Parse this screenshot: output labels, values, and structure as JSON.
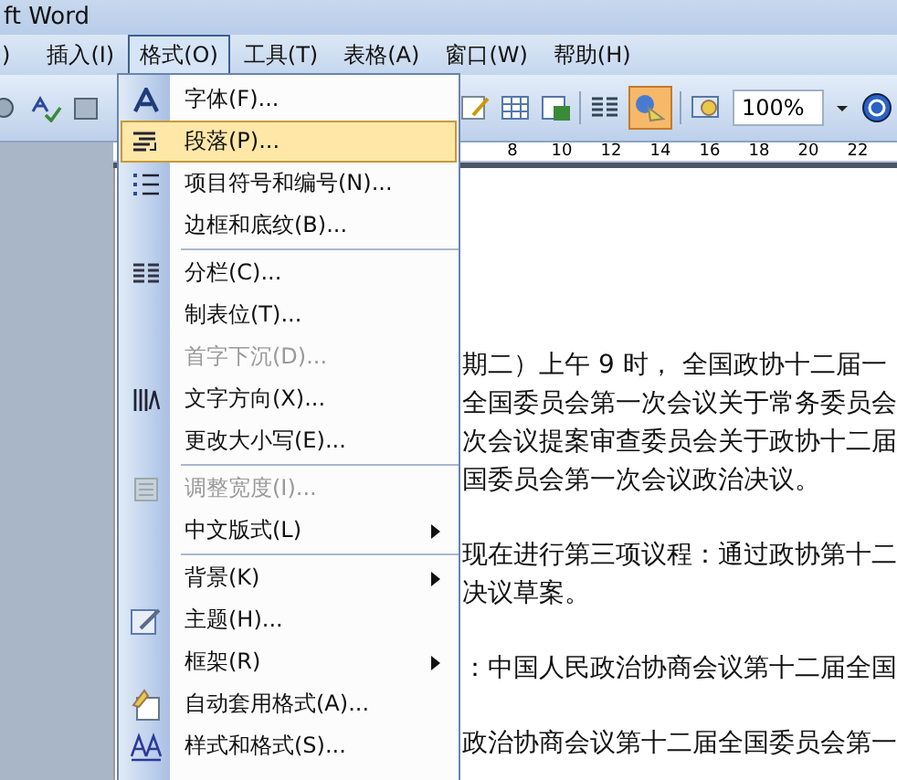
{
  "window": {
    "title": "ft Word"
  },
  "menu_bar": [
    {
      "label": ")",
      "selected": false
    },
    {
      "label": "插入(I)",
      "selected": false
    },
    {
      "label": "格式(O)",
      "selected": true
    },
    {
      "label": "工具(T)",
      "selected": false
    },
    {
      "label": "表格(A)",
      "selected": false
    },
    {
      "label": "窗口(W)",
      "selected": false
    },
    {
      "label": "帮助(H)",
      "selected": false
    }
  ],
  "toolbar": {
    "zoom": "100%"
  },
  "ruler": {
    "labels": [
      "8",
      "10",
      "12",
      "14",
      "16",
      "18",
      "20",
      "22"
    ]
  },
  "format_menu": {
    "groups": [
      [
        {
          "label": "字体(F)...",
          "disabled": false,
          "submenu": false,
          "selected": false
        },
        {
          "label": "段落(P)...",
          "disabled": false,
          "submenu": false,
          "selected": true
        },
        {
          "label": "项目符号和编号(N)...",
          "disabled": false,
          "submenu": false,
          "selected": false
        },
        {
          "label": "边框和底纹(B)...",
          "disabled": false,
          "submenu": false,
          "selected": false
        }
      ],
      [
        {
          "label": "分栏(C)...",
          "disabled": false,
          "submenu": false,
          "selected": false
        },
        {
          "label": "制表位(T)...",
          "disabled": false,
          "submenu": false,
          "selected": false
        },
        {
          "label": "首字下沉(D)...",
          "disabled": true,
          "submenu": false,
          "selected": false
        },
        {
          "label": "文字方向(X)...",
          "disabled": false,
          "submenu": false,
          "selected": false
        },
        {
          "label": "更改大小写(E)...",
          "disabled": false,
          "submenu": false,
          "selected": false
        }
      ],
      [
        {
          "label": "调整宽度(I)...",
          "disabled": true,
          "submenu": false,
          "selected": false
        },
        {
          "label": "中文版式(L)",
          "disabled": false,
          "submenu": true,
          "selected": false
        }
      ],
      [
        {
          "label": "背景(K)",
          "disabled": false,
          "submenu": true,
          "selected": false
        },
        {
          "label": "主题(H)...",
          "disabled": false,
          "submenu": false,
          "selected": false
        },
        {
          "label": "框架(R)",
          "disabled": false,
          "submenu": true,
          "selected": false
        },
        {
          "label": "自动套用格式(A)...",
          "disabled": false,
          "submenu": false,
          "selected": false
        },
        {
          "label": "样式和格式(S)...",
          "disabled": false,
          "submenu": false,
          "selected": false
        }
      ]
    ]
  },
  "document": {
    "paragraphs": [
      [
        "期二）上午 9 时， 全国政协十二届一",
        "全国委员会第一次会议关于常务委员会",
        "次会议提案审查委员会关于政协十二届",
        "国委员会第一次会议政治决议。"
      ],
      [
        "现在进行第三项议程：通过政协第十二",
        "决议草案。"
      ],
      [
        "：中国人民政治协商会议第十二届全国"
      ],
      [
        "政治协商会议第十二届全国委员会第一"
      ]
    ]
  }
}
